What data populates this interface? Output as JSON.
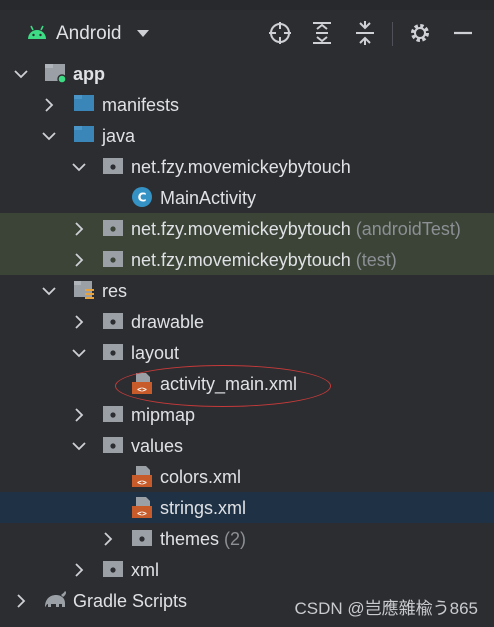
{
  "toolbar": {
    "view_label": "Android",
    "icons": [
      "android-icon",
      "chevron-down-icon",
      "locate-icon",
      "expand-all-icon",
      "collapse-all-icon",
      "gear-icon",
      "minimize-icon"
    ]
  },
  "tree": {
    "app": "app",
    "manifests": "manifests",
    "java": "java",
    "pkg_main": "net.fzy.movemickeybytouch",
    "main_activity": "MainActivity",
    "pkg_android_test": "net.fzy.movemickeybytouch",
    "pkg_android_test_suffix": "(androidTest)",
    "pkg_test": "net.fzy.movemickeybytouch",
    "pkg_test_suffix": "(test)",
    "res": "res",
    "drawable": "drawable",
    "layout": "layout",
    "activity_main": "activity_main.xml",
    "mipmap": "mipmap",
    "values": "values",
    "colors": "colors.xml",
    "strings": "strings.xml",
    "themes": "themes",
    "themes_count": "(2)",
    "xml": "xml",
    "gradle": "Gradle Scripts"
  },
  "colors": {
    "background": "#2b2d30",
    "test_highlight": "#3b4437",
    "selection": "#1f3144",
    "annotation": "#c53a3a"
  },
  "watermark": "CSDN @岂應雜楡う865"
}
